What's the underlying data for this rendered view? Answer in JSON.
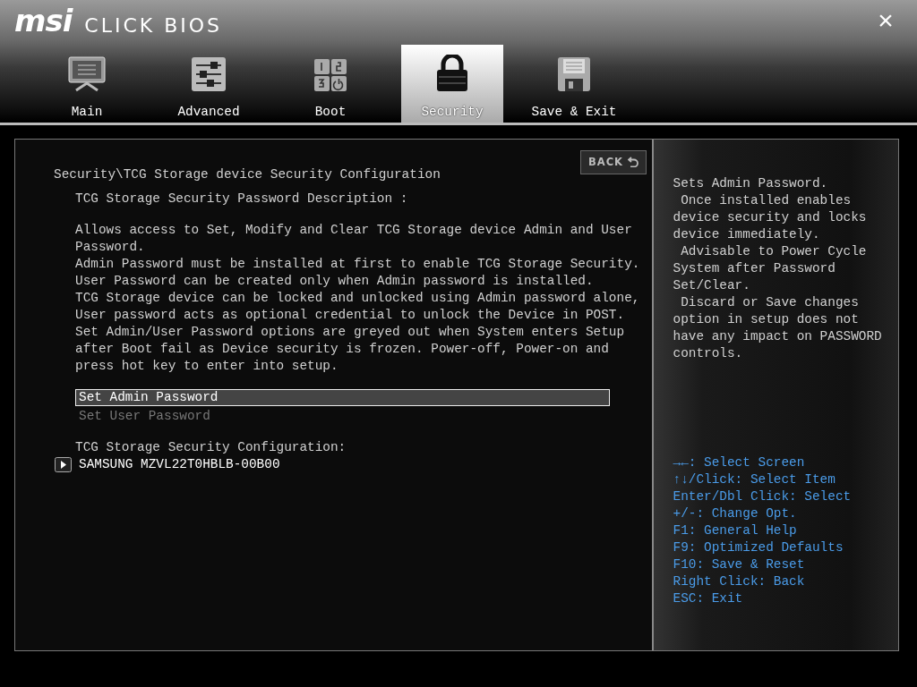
{
  "header": {
    "brand": "msi",
    "product": "CLICK BIOS",
    "close": "×"
  },
  "tabs": [
    {
      "label": "Main",
      "selected": false
    },
    {
      "label": "Advanced",
      "selected": false
    },
    {
      "label": "Boot",
      "selected": false
    },
    {
      "label": "Security",
      "selected": true
    },
    {
      "label": "Save & Exit",
      "selected": false
    }
  ],
  "content": {
    "back_button": "BACK",
    "breadcrumb": "Security\\TCG Storage device Security Configuration",
    "description_title": "TCG Storage Security Password Description :",
    "description": [
      "Allows access to Set, Modify and Clear TCG Storage device Admin and User",
      "Password.",
      "Admin Password must be installed at first to enable TCG Storage Security.",
      "User Password can be created only when Admin password is installed.",
      "TCG Storage device can be locked and unlocked using Admin password alone,",
      "User password acts as optional credential to unlock the Device in POST.",
      "Set Admin/User Password options are greyed out when System enters Setup",
      "after Boot fail as Device security is frozen. Power-off, Power-on and",
      "press hot key to enter into setup."
    ],
    "options": [
      {
        "label": "Set Admin Password",
        "selected": true,
        "disabled": false
      },
      {
        "label": "Set User Password",
        "selected": false,
        "disabled": true
      }
    ],
    "section_title": "TCG Storage Security Configuration:",
    "devices": [
      {
        "label": "SAMSUNG MZVL22T0HBLB-00B00"
      }
    ]
  },
  "help": {
    "text": [
      "Sets Admin Password.",
      " Once installed enables",
      "device security and locks",
      "device immediately.",
      " Advisable to Power Cycle",
      "System after Password",
      "Set/Clear.",
      " Discard or Save changes",
      "option in setup does not",
      "have any impact on PASSWORD",
      "controls."
    ],
    "keys": [
      "→←: Select Screen",
      "↑↓/Click: Select Item",
      "Enter/Dbl Click: Select",
      "+/-: Change Opt.",
      "F1: General Help",
      "F9: Optimized Defaults",
      "F10: Save & Reset",
      "Right Click: Back",
      "ESC: Exit"
    ]
  }
}
